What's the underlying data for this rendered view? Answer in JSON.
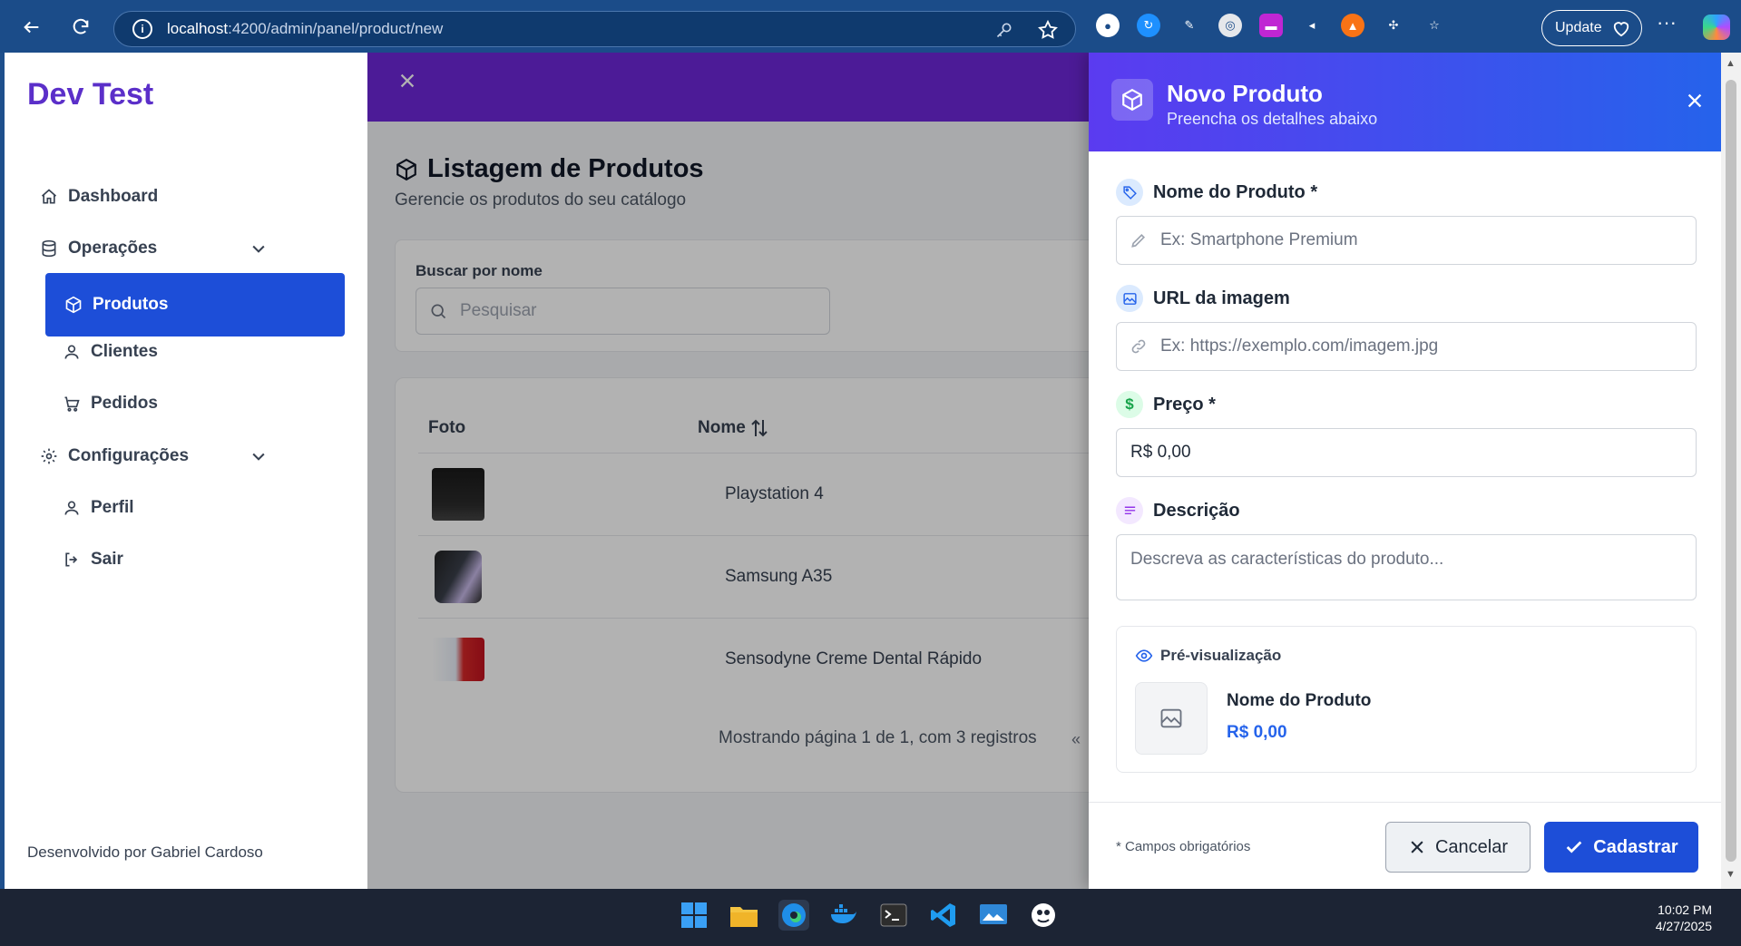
{
  "browser": {
    "url_host": "localhost",
    "url_path": ":4200/admin/panel/product/new",
    "update_label": "Update"
  },
  "sidebar": {
    "brand": "Dev Test",
    "items": [
      {
        "label": "Dashboard",
        "icon": "home-icon"
      },
      {
        "label": "Operações",
        "icon": "database-icon"
      },
      {
        "label": "Produtos",
        "icon": "box-icon",
        "active": true
      },
      {
        "label": "Clientes",
        "icon": "user-icon"
      },
      {
        "label": "Pedidos",
        "icon": "cart-icon"
      },
      {
        "label": "Configurações",
        "icon": "gear-icon"
      },
      {
        "label": "Perfil",
        "icon": "user-icon"
      },
      {
        "label": "Sair",
        "icon": "logout-icon"
      }
    ],
    "footer": "Desenvolvido por Gabriel Cardoso"
  },
  "main": {
    "title": "Listagem de Produtos",
    "subtitle": "Gerencie os produtos do seu catálogo",
    "search": {
      "label": "Buscar por nome",
      "placeholder": "Pesquisar"
    },
    "table": {
      "columns": [
        "Foto",
        "Nome"
      ],
      "rows": [
        {
          "name": "Playstation 4"
        },
        {
          "name": "Samsung A35"
        },
        {
          "name": "Sensodyne Creme Dental Rápido"
        }
      ],
      "pagination": "Mostrando página 1 de 1, com 3 registros"
    }
  },
  "drawer": {
    "title": "Novo Produto",
    "subtitle": "Preencha os detalhes abaixo",
    "fields": {
      "name": {
        "label": "Nome do Produto *",
        "placeholder": "Ex: Smartphone Premium"
      },
      "image": {
        "label": "URL da imagem",
        "placeholder": "Ex: https://exemplo.com/imagem.jpg"
      },
      "price": {
        "label": "Preço *",
        "value": "R$ 0,00"
      },
      "description": {
        "label": "Descrição",
        "placeholder": "Descreva as características do produto..."
      }
    },
    "preview": {
      "label": "Pré-visualização",
      "name": "Nome do Produto",
      "price": "R$ 0,00"
    },
    "footer": {
      "required_note": "* Campos obrigatórios",
      "cancel_label": "Cancelar",
      "submit_label": "Cadastrar"
    }
  },
  "taskbar": {
    "time": "10:02 PM",
    "date": "4/27/2025"
  },
  "colors": {
    "brand": "#5b2fc9",
    "primary": "#1d4ed8",
    "topbar": "#6d28d9"
  }
}
